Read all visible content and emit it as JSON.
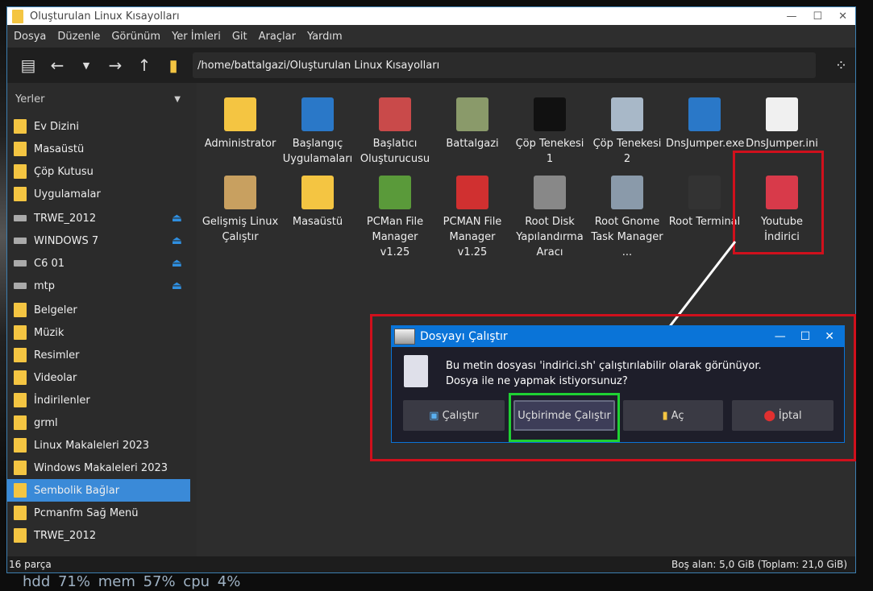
{
  "window": {
    "title": "Oluşturulan Linux Kısayolları",
    "controls": [
      "—",
      "☐",
      "✕"
    ]
  },
  "menu": [
    "Dosya",
    "Düzenle",
    "Görünüm",
    "Yer İmleri",
    "Git",
    "Araçlar",
    "Yardım"
  ],
  "toolbar": {
    "path": "/home/battalgazi/Oluşturulan Linux Kısayolları"
  },
  "sidebar": {
    "header": "Yerler",
    "places": [
      "Ev Dizini",
      "Masaüstü",
      "Çöp Kutusu",
      "Uygulamalar"
    ],
    "devices": [
      "TRWE_2012",
      "WINDOWS 7",
      "C6 01",
      "mtp"
    ],
    "bookmarks": [
      "Belgeler",
      "Müzik",
      "Resimler",
      "Videolar",
      "İndirilenler",
      "grml",
      "Linux Makaleleri 2023",
      "Windows Makaleleri 2023",
      "Sembolik Bağlar",
      "Pcmanfm Sağ Menü",
      "TRWE_2012"
    ],
    "selected": "Sembolik Bağlar"
  },
  "files": [
    {
      "label": "Administrator",
      "color": "#f4c542"
    },
    {
      "label": "Başlangıç Uygulamaları",
      "color": "#2a78c8"
    },
    {
      "label": "Başlatıcı Oluşturucusu",
      "color": "#c94a4a"
    },
    {
      "label": "Battalgazi",
      "color": "#8a9a6a"
    },
    {
      "label": "Çöp Tenekesi 1",
      "color": "#111111"
    },
    {
      "label": "Çöp Tenekesi 2",
      "color": "#a8b8c8"
    },
    {
      "label": "DnsJumper.exe",
      "color": "#2a78c8"
    },
    {
      "label": "DnsJumper.ini",
      "color": "#f0f0f0"
    },
    {
      "label": "Gelişmiş Linux Çalıştır",
      "color": "#c8a060"
    },
    {
      "label": "Masaüstü",
      "color": "#f4c542"
    },
    {
      "label": "PCMan File Manager v1.25",
      "color": "#5a9a3a"
    },
    {
      "label": "PCMAN File Manager v1.25",
      "color": "#d03030"
    },
    {
      "label": "Root Disk Yapılandırma Aracı",
      "color": "#888888"
    },
    {
      "label": "Root Gnome Task Manager ...",
      "color": "#8a9aaa"
    },
    {
      "label": "Root Terminal",
      "color": "#333333"
    },
    {
      "label": "Youtube İndirici",
      "color": "#d83a4a"
    }
  ],
  "status": {
    "count": "16 parça",
    "free": "Boş alan: 5,0 GiB (Toplam: 21,0 GiB)"
  },
  "dialog": {
    "title": "Dosyayı Çalıştır",
    "line1": "Bu metin dosyası 'indirici.sh' çalıştırılabilir olarak görünüyor.",
    "line2": "Dosya ile ne yapmak istiyorsunuz?",
    "buttons": [
      "Çalıştır",
      "Uçbirimde Çalıştır",
      "Aç",
      "İptal"
    ]
  },
  "sysmon": "hdd 71% mem 57% cpu 4%",
  "colors": {
    "highlight_red": "#d0101c",
    "highlight_green": "#1fd133",
    "accent": "#3a8ad8"
  }
}
